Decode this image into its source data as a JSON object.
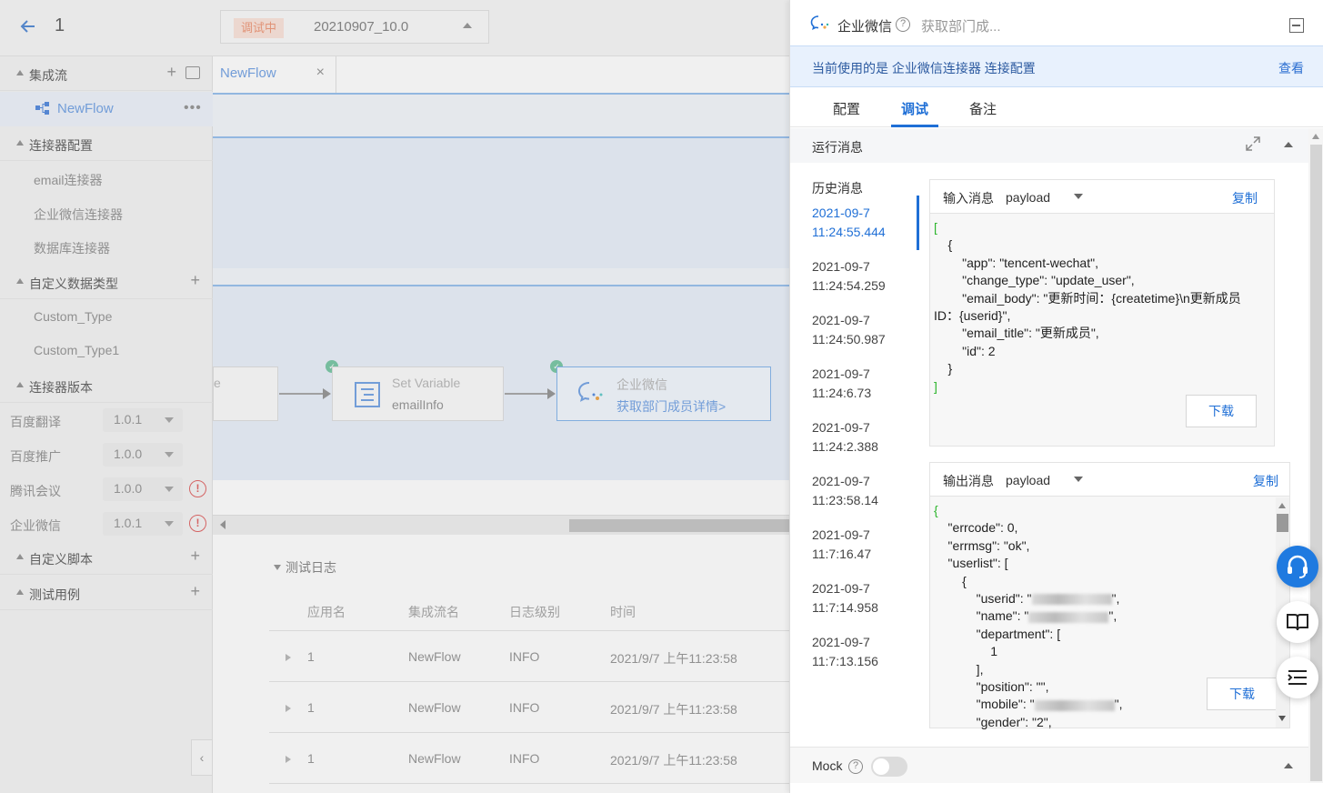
{
  "topbar": {
    "app_id": "1",
    "status_badge": "调试中",
    "version": "20210907_10.0"
  },
  "sidebar": {
    "integration_flow": {
      "label": "集成流",
      "items": [
        {
          "label": "NewFlow"
        }
      ]
    },
    "connector_config": {
      "label": "连接器配置",
      "items": [
        "email连接器",
        "企业微信连接器",
        "数据库连接器"
      ]
    },
    "custom_types": {
      "label": "自定义数据类型",
      "items": [
        "Custom_Type",
        "Custom_Type1"
      ]
    },
    "connector_versions": {
      "label": "连接器版本",
      "items": [
        {
          "name": "百度翻译",
          "version": "1.0.1",
          "warn": false
        },
        {
          "name": "百度推广",
          "version": "1.0.0",
          "warn": false
        },
        {
          "name": "腾讯会议",
          "version": "1.0.0",
          "warn": true
        },
        {
          "name": "企业微信",
          "version": "1.0.1",
          "warn": true
        }
      ]
    },
    "custom_scripts": {
      "label": "自定义脚本"
    },
    "test_cases": {
      "label": "测试用例"
    }
  },
  "editor": {
    "tab_label": "NewFlow",
    "nodes": {
      "partial_label": "e",
      "set_variable": {
        "title": "Set Variable",
        "sub": "emailInfo"
      },
      "wechat": {
        "title": "企业微信",
        "sub": "获取部门成员详情>"
      }
    }
  },
  "test_log": {
    "title": "测试日志",
    "columns": [
      "应用名",
      "集成流名",
      "日志级别",
      "时间"
    ],
    "rows": [
      {
        "app": "1",
        "flow": "NewFlow",
        "level": "INFO",
        "time": "2021/9/7 上午11:23:58"
      },
      {
        "app": "1",
        "flow": "NewFlow",
        "level": "INFO",
        "time": "2021/9/7 上午11:23:58"
      },
      {
        "app": "1",
        "flow": "NewFlow",
        "level": "INFO",
        "time": "2021/9/7 上午11:23:58"
      }
    ]
  },
  "panel": {
    "connector_name": "企业微信",
    "action": "获取部门成...",
    "banner_text": "当前使用的是 企业微信连接器 连接配置",
    "banner_link": "查看",
    "tabs": [
      "配置",
      "调试",
      "备注"
    ],
    "run_title": "运行消息",
    "history_title": "历史消息",
    "history": [
      {
        "date": "2021-09-7",
        "time": "11:24:55.444"
      },
      {
        "date": "2021-09-7",
        "time": "11:24:54.259"
      },
      {
        "date": "2021-09-7",
        "time": "11:24:50.987"
      },
      {
        "date": "2021-09-7",
        "time": "11:24:6.73"
      },
      {
        "date": "2021-09-7",
        "time": "11:24:2.388"
      },
      {
        "date": "2021-09-7",
        "time": "11:23:58.14"
      },
      {
        "date": "2021-09-7",
        "time": "11:7:16.47"
      },
      {
        "date": "2021-09-7",
        "time": "11:7:14.958"
      },
      {
        "date": "2021-09-7",
        "time": "11:7:13.156"
      }
    ],
    "input_msg": {
      "label": "输入消息",
      "type": "payload",
      "copy": "复制",
      "download": "下载",
      "code_lines": [
        "[",
        "    {",
        "        \"app\": \"tencent-wechat\",",
        "        \"change_type\": \"update_user\",",
        "        \"email_body\": \"更新时间：{createtime}\\n更新成员",
        "ID：{userid}\",",
        "        \"email_title\": \"更新成员\",",
        "        \"id\": 2",
        "    }",
        "]"
      ]
    },
    "output_msg": {
      "label": "输出消息",
      "type": "payload",
      "copy": "复制",
      "download": "下载",
      "code_lines": [
        "{",
        "    \"errcode\": 0,",
        "    \"errmsg\": \"ok\",",
        "    \"userlist\": [",
        "        {",
        "            \"userid\": \"",
        "            \"name\": \"",
        "            \"department\": [",
        "                1",
        "            ],",
        "            \"position\": \"\",",
        "            \"mobile\": \"",
        "            \"gender\": \"2\","
      ]
    },
    "mock_label": "Mock"
  }
}
